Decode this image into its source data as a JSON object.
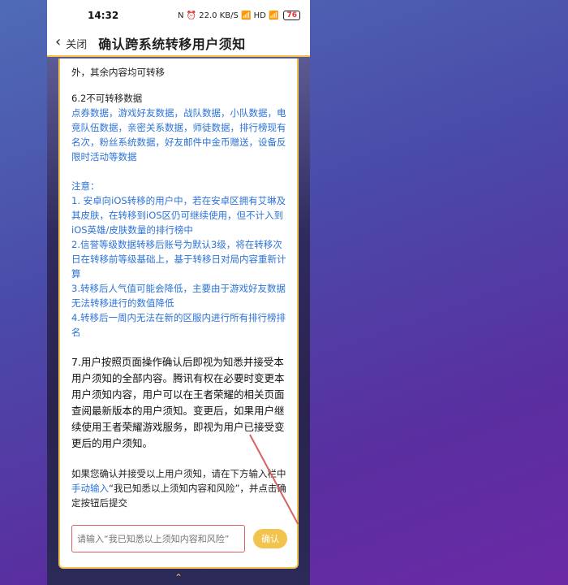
{
  "status_bar": {
    "time": "14:32",
    "icons_text": "N ⏰ 22.0 KB/S 📶 HD 📶",
    "battery_level": "76"
  },
  "header": {
    "back_label": "关闭",
    "title": "确认跨系统转移用户须知"
  },
  "content": {
    "line_intro": "外，其余内容均可转移",
    "section_6_2_title": "6.2不可转移数据",
    "section_6_2_text": "点券数据，游戏好友数据，战队数据，小队数据，电竞队伍数据，亲密关系数据，师徒数据，排行榜现有名次，粉丝系统数据，好友邮件中金币赠送，设备反限时活动等数据",
    "notice_title": "注意：",
    "notice_1": "1. 安卓向iOS转移的用户中，若在安卓区拥有艾琳及其皮肤，在转移到iOS区仍可继续使用，但不计入到iOS英雄/皮肤数量的排行榜中",
    "notice_2": "2.信誉等级数据转移后账号为默认3级，将在转移次日在转移前等级基础上，基于转移日对局内容重新计算",
    "notice_3": "3.转移后人气值可能会降低，主要由于游戏好友数据无法转移进行的数值降低",
    "notice_4": "4.转移后一周内无法在新的区服内进行所有排行榜排名",
    "section_7": "7.用户按照页面操作确认后即视为知悉并接受本用户须知的全部内容。腾讯有权在必要时变更本用户须知内容，用户可以在王者荣耀的相关页面查阅最新版本的用户须知。变更后，如果用户继续使用王者荣耀游戏服务，即视为用户已接受变更后的用户须知。",
    "final_part1": "如果您确认并接受以上用户须知，请在下方输入栏中",
    "final_link": "手动输入",
    "final_part2": "“我已知悉以上须知内容和风险”，并点击确定按钮后提交"
  },
  "confirm": {
    "placeholder": "请输入“我已知悉以上须知内容和风险”",
    "button_label": "确认"
  },
  "colors": {
    "accent_yellow": "#f2c44d",
    "link_blue": "#2d73d6",
    "annotation_red": "#d76262"
  },
  "icons": {
    "back": "chevron-left-icon",
    "annotation": "red-arrow-icon",
    "bottom_hint": "caret-up-icon"
  }
}
